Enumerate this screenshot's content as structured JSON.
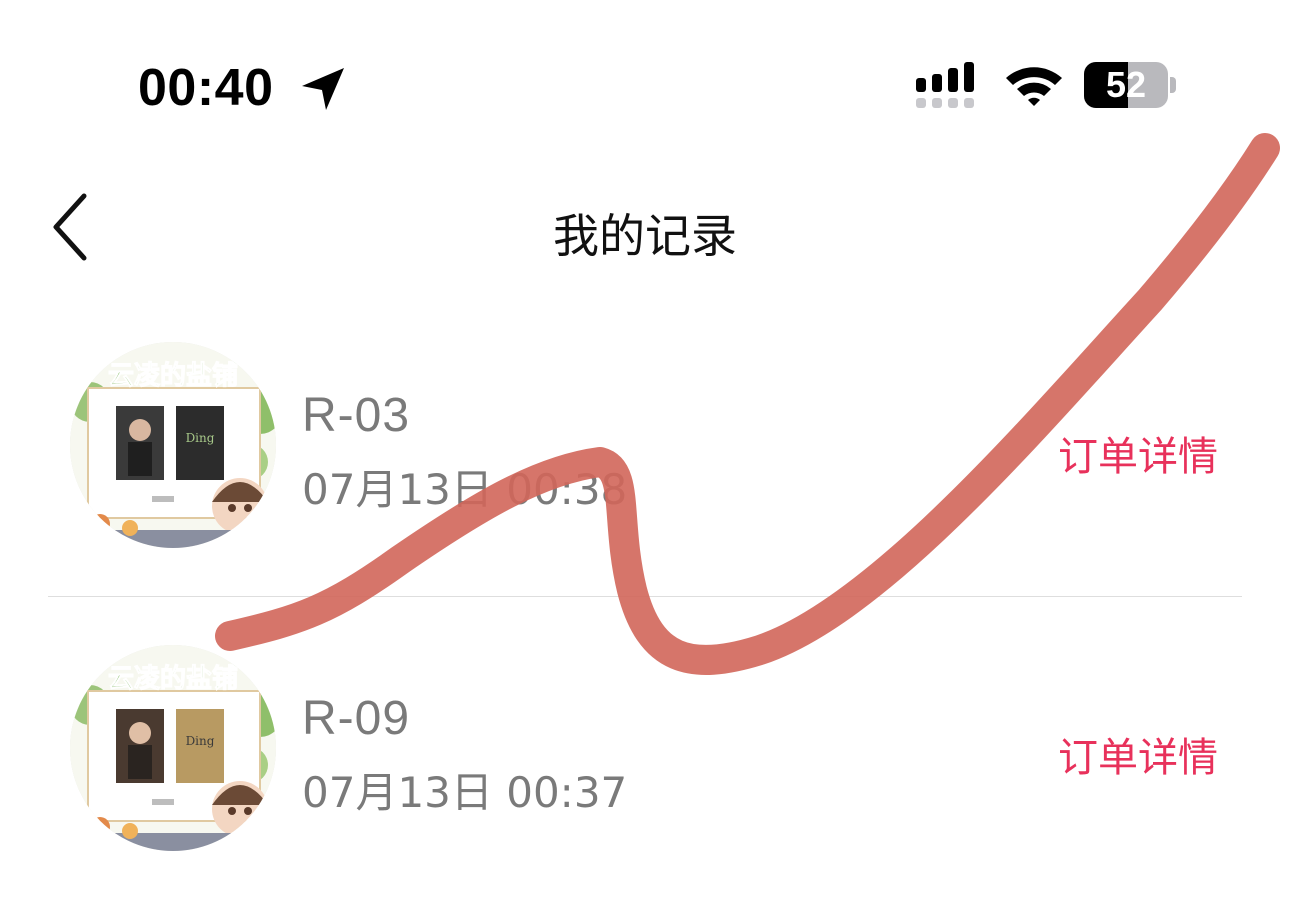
{
  "status_bar": {
    "time": "00:40",
    "battery_level": "52",
    "battery_percent": 52
  },
  "nav": {
    "title": "我的记录"
  },
  "records": [
    {
      "code": "R-03",
      "datetime": "07月13日 00:38",
      "action": "订单详情"
    },
    {
      "code": "R-09",
      "datetime": "07月13日 00:37",
      "action": "订单详情"
    }
  ],
  "thumbnail_banner_text": "云凌的盐铺",
  "colors": {
    "accent": "#e8315b",
    "secondary_text": "#7a7a7a",
    "scribble": "#d2665a"
  },
  "icons": [
    "location-arrow-icon",
    "signal-icon",
    "wifi-icon",
    "battery-icon",
    "back-chevron-icon"
  ]
}
